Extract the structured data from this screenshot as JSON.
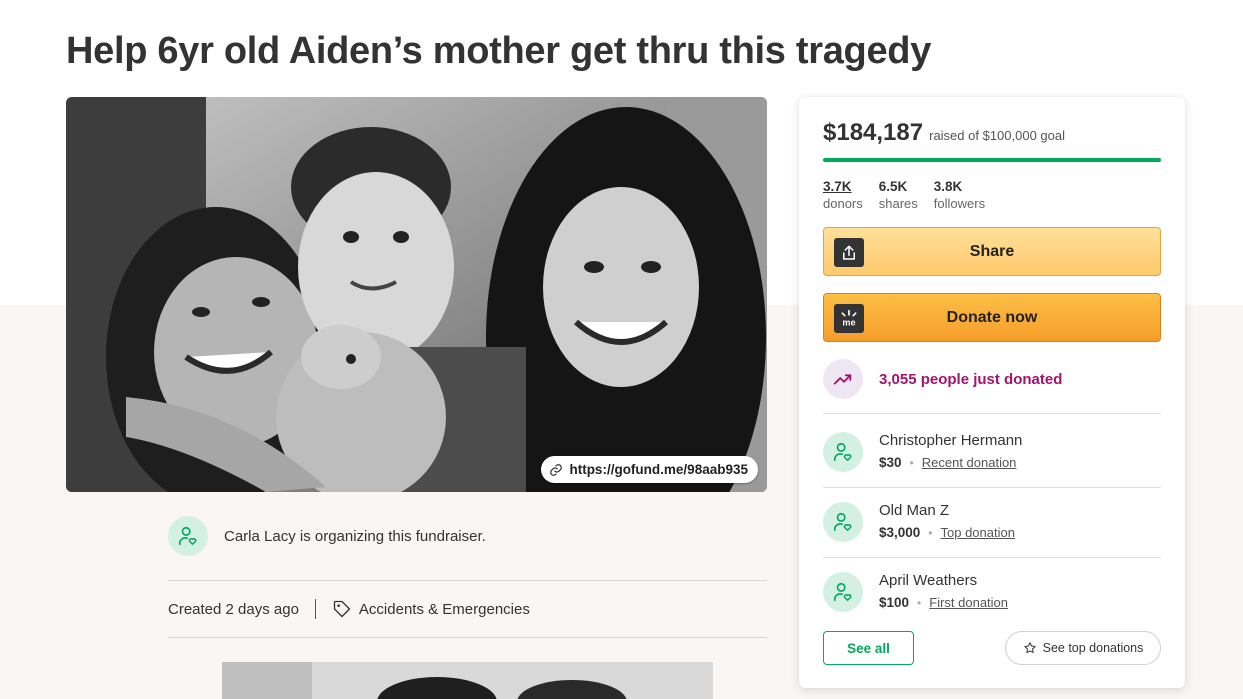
{
  "page": {
    "title": "Help 6yr old Aiden’s mother get thru this tragedy"
  },
  "hero": {
    "short_url": "https://gofund.me/98aab935",
    "link_icon": "link-icon"
  },
  "organizer": {
    "text": "Carla Lacy is organizing this fundraiser.",
    "icon": "user-heart-icon"
  },
  "meta": {
    "created": "Created 2 days ago",
    "category": "Accidents & Emergencies",
    "category_icon": "tag-icon"
  },
  "sidebar": {
    "raised_amount": "$184,187",
    "raised_goal": "raised of $100,000 goal",
    "progress_fraction": 1.0,
    "stats": [
      {
        "value": "3.7K",
        "label": "donors"
      },
      {
        "value": "6.5K",
        "label": "shares"
      },
      {
        "value": "3.8K",
        "label": "followers"
      }
    ],
    "share_label": "Share",
    "donate_label": "Donate now",
    "trend_text": "3,055 people just donated",
    "donations": [
      {
        "name": "Christopher Hermann",
        "amount": "$30",
        "tag": "Recent donation"
      },
      {
        "name": "Old Man Z",
        "amount": "$3,000",
        "tag": "Top donation"
      },
      {
        "name": "April Weathers",
        "amount": "$100",
        "tag": "First donation"
      }
    ],
    "see_all_label": "See all",
    "see_top_label": "See top donations"
  },
  "colors": {
    "brand_green": "#02a95c",
    "trend_purple": "#a2136f",
    "donate_orange": "#f59d2a",
    "share_yellow": "#ffd87f"
  }
}
